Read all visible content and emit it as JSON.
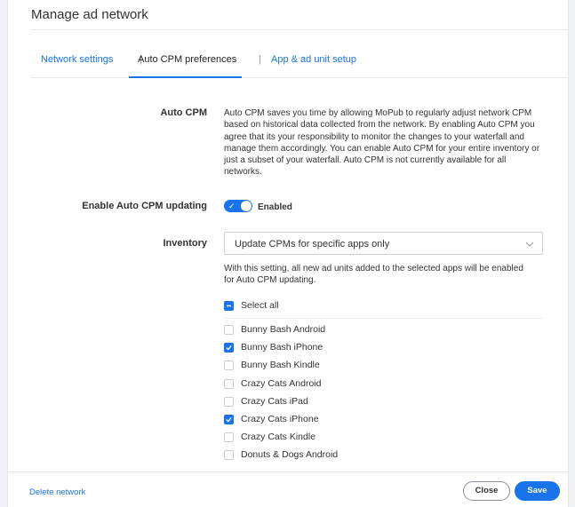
{
  "modal": {
    "title": "Manage ad network"
  },
  "tabs": [
    {
      "label": "Network settings"
    },
    {
      "label": "Auto CPM preferences"
    },
    {
      "label": "App & ad unit setup"
    }
  ],
  "tab_separator": "|",
  "auto_cpm": {
    "label": "Auto CPM",
    "description": "Auto CPM saves you time by allowing MoPub to regularly adjust network CPM based on historical data collected from the network. By enabling Auto CPM you agree that its your responsibility to monitor the changes to your waterfall and manage them accordingly. You can enable Auto CPM for your entire inventory or just a subset of your waterfall. Auto CPM is not currently available for all networks."
  },
  "enable_updating": {
    "label": "Enable Auto CPM updating",
    "status": "Enabled",
    "on": true
  },
  "inventory": {
    "label": "Inventory",
    "selected": "Update CPMs for specific apps only",
    "note": "With this setting, all new ad units added to the selected apps will be enabled for Auto CPM updating.",
    "select_all": "Select all",
    "apps": [
      {
        "name": "Bunny Bash Android",
        "checked": false
      },
      {
        "name": "Bunny Bash iPhone",
        "checked": true
      },
      {
        "name": "Bunny Bash Kindle",
        "checked": false
      },
      {
        "name": "Crazy Cats Android",
        "checked": false
      },
      {
        "name": "Crazy Cats iPad",
        "checked": false
      },
      {
        "name": "Crazy Cats iPhone",
        "checked": true
      },
      {
        "name": "Crazy Cats Kindle",
        "checked": false
      },
      {
        "name": "Donuts & Dogs Android",
        "checked": false
      }
    ]
  },
  "footer": {
    "delete_label": "Delete network",
    "close_label": "Close",
    "save_label": "Save"
  },
  "colors": {
    "accent": "#1a73e8",
    "text": "#333333",
    "border": "#e6e8eb"
  },
  "icons": {
    "toggle_check": "check-icon",
    "select_chevron": "chevron-down-icon",
    "checkbox_check": "check-icon",
    "select_all_partial": "minus-icon"
  }
}
